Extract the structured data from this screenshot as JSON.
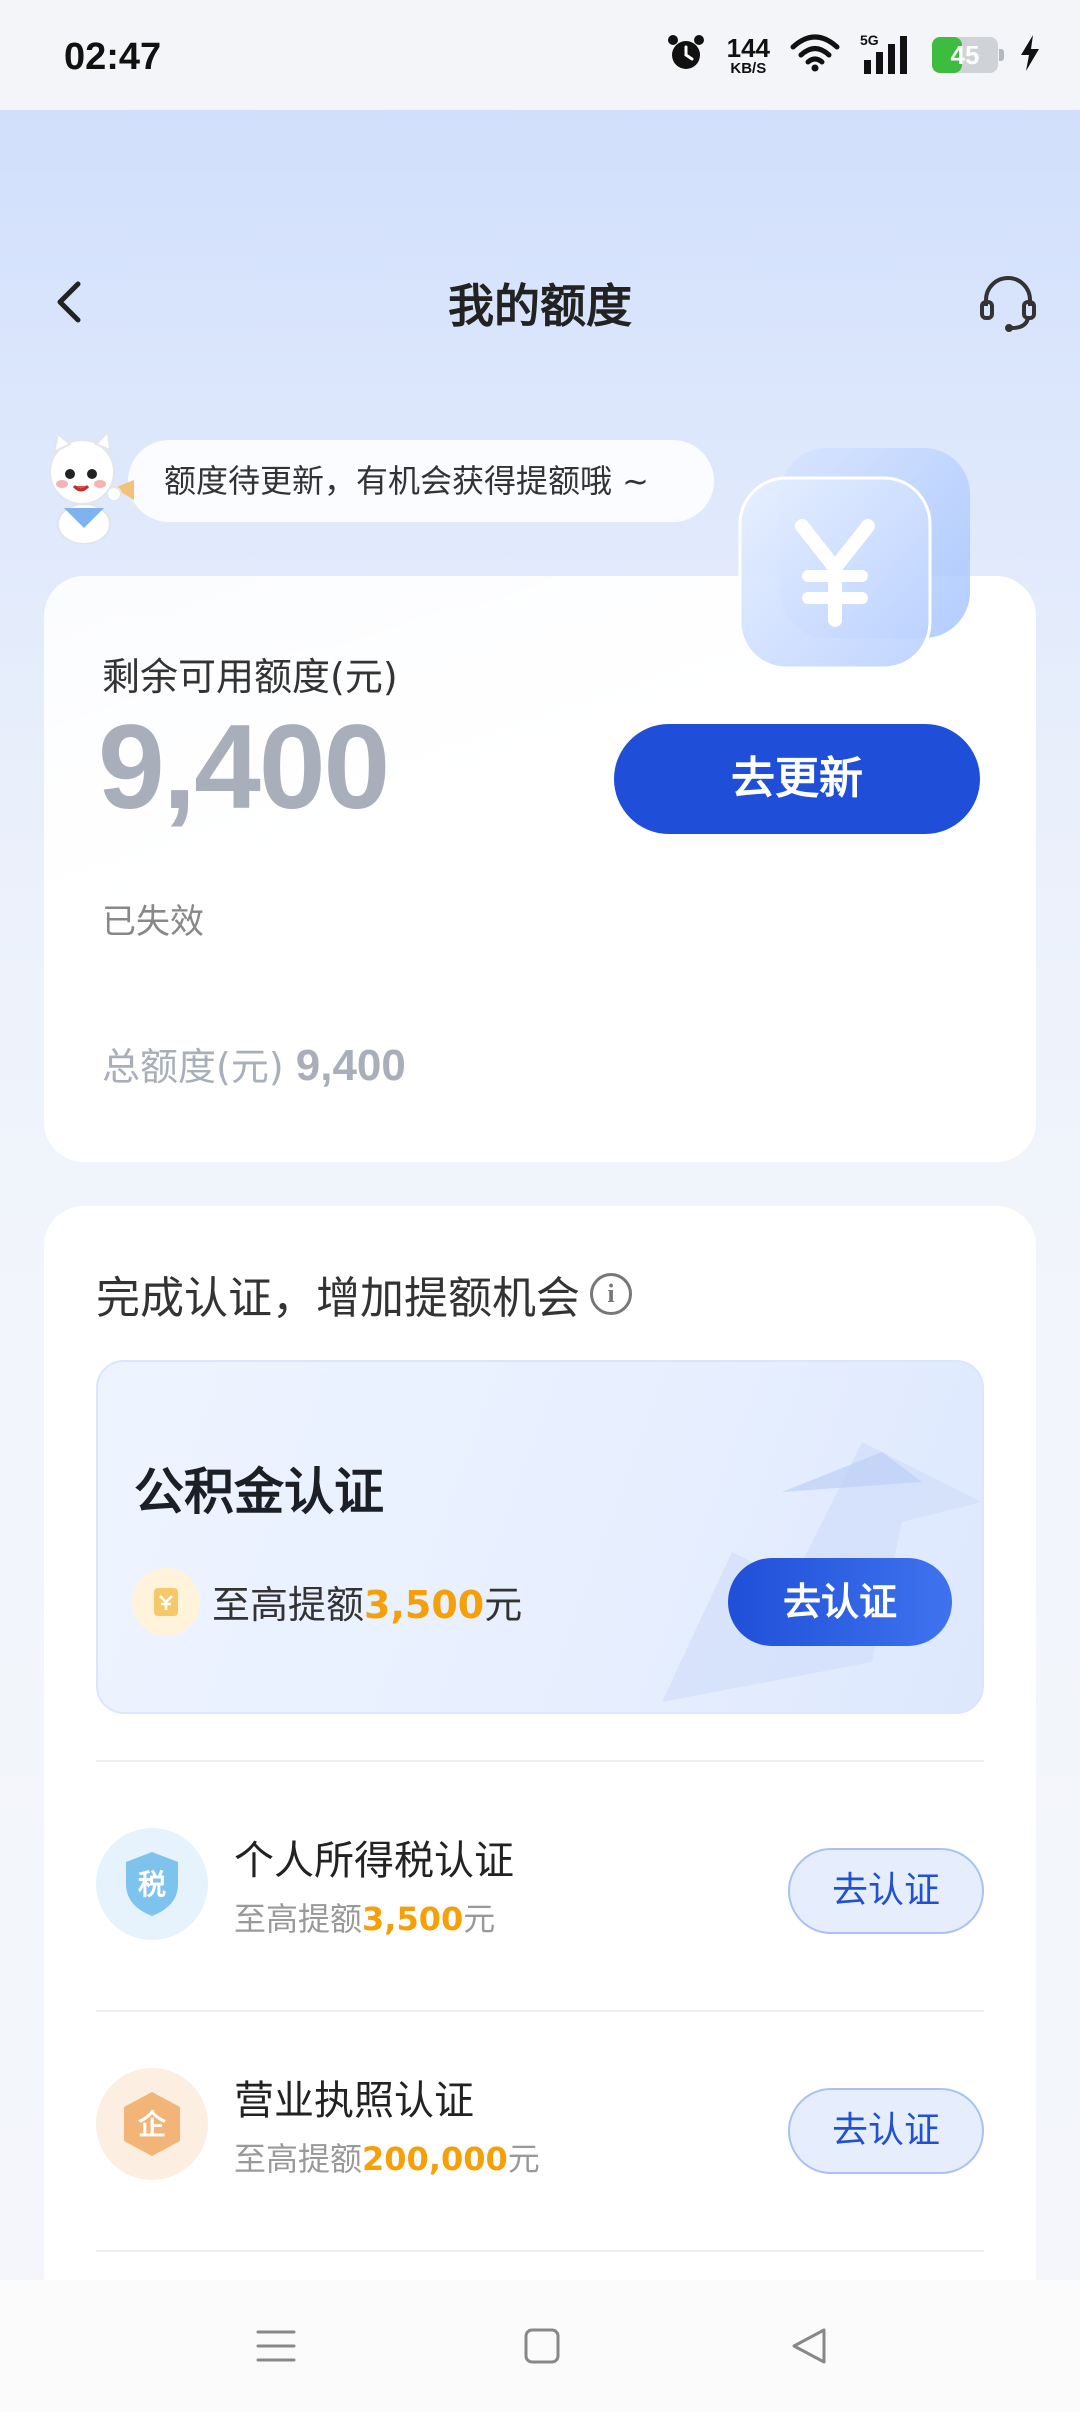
{
  "status_bar": {
    "time": "02:47",
    "net_speed_value": "144",
    "net_speed_unit": "KB/S",
    "network_type": "5G",
    "battery_level": "45",
    "battery_fraction": 0.45,
    "icons": [
      "alarm-icon",
      "wifi-icon",
      "signal-icon",
      "battery-icon",
      "charging-icon"
    ]
  },
  "header": {
    "title": "我的额度",
    "back_icon": "chevron-left-icon",
    "service_icon": "headset-icon"
  },
  "tip": {
    "text": "额度待更新，有机会获得提额哦 ~"
  },
  "quota": {
    "label": "剩余可用额度(元)",
    "amount": "9,400",
    "update_button": "去更新",
    "status": "已失效",
    "total_label": "总额度(元)",
    "total_value": "9,400"
  },
  "certification": {
    "title": "完成认证，增加提额机会",
    "featured": {
      "name": "公积金认证",
      "limit_prefix": "至高提额",
      "limit_value": "3,500",
      "limit_suffix": "元",
      "button": "去认证"
    },
    "items": [
      {
        "name": "个人所得税认证",
        "icon_text": "税",
        "limit_prefix": "至高提额",
        "limit_value": "3,500",
        "limit_suffix": "元",
        "button": "去认证"
      },
      {
        "name": "营业执照认证",
        "icon_text": "企",
        "limit_prefix": "至高提额",
        "limit_value": "200,000",
        "limit_suffix": "元",
        "button": "去认证"
      }
    ]
  },
  "colors": {
    "primary": "#1f4fd8",
    "accent": "#f5a009",
    "muted_amount": "#a9afba"
  },
  "nav_bar": {
    "icons": [
      "menu-icon",
      "home-icon",
      "back-triangle-icon"
    ]
  }
}
